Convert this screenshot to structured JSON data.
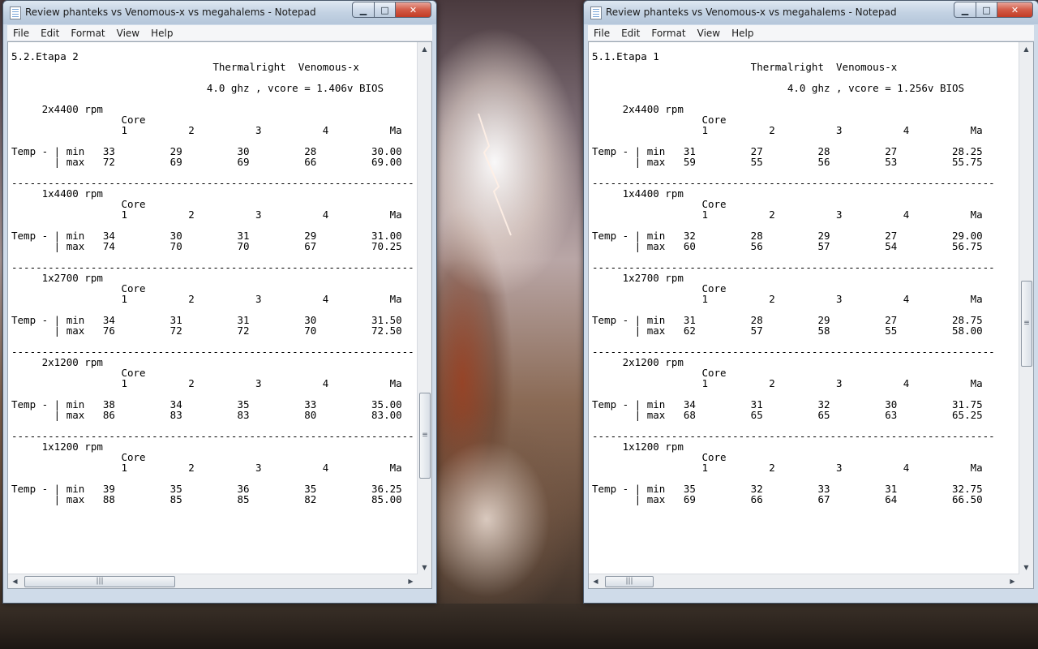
{
  "left_window": {
    "title": "Review phanteks vs Venomous-x vs megahalems - Notepad",
    "menu": [
      "File",
      "Edit",
      "Format",
      "View",
      "Help"
    ],
    "content": "5.2.Etapa 2\n                                 Thermalright  Venomous-x\n\n                                4.0 ghz , vcore = 1.406v BIOS\n\n     2x4400 rpm\n                  Core\n                  1          2          3          4          Ma\n\nTemp - | min   33         29         30         28         30.00\n       | max   72         69         69         66         69.00\n\n------------------------------------------------------------------\n     1x4400 rpm\n                  Core\n                  1          2          3          4          Ma\n\nTemp - | min   34         30         31         29         31.00\n       | max   74         70         70         67         70.25\n\n------------------------------------------------------------------\n     1x2700 rpm\n                  Core\n                  1          2          3          4          Ma\n\nTemp - | min   34         31         31         30         31.50\n       | max   76         72         72         70         72.50\n\n------------------------------------------------------------------\n     2x1200 rpm\n                  Core\n                  1          2          3          4          Ma\n\nTemp - | min   38         34         35         33         35.00\n       | max   86         83         83         80         83.00\n\n------------------------------------------------------------------\n     1x1200 rpm\n                  Core\n                  1          2          3          4          Ma\n\nTemp - | min   39         35         36         35         36.25\n       | max   88         85         85         82         85.00"
  },
  "right_window": {
    "title": "Review phanteks vs Venomous-x vs megahalems - Notepad",
    "menu": [
      "File",
      "Edit",
      "Format",
      "View",
      "Help"
    ],
    "content": "5.1.Etapa 1\n                          Thermalright  Venomous-x\n\n                                4.0 ghz , vcore = 1.256v BIOS\n\n     2x4400 rpm\n                  Core\n                  1          2          3          4          Ma\n\nTemp - | min   31         27         28         27         28.25\n       | max   59         55         56         53         55.75\n\n------------------------------------------------------------------\n     1x4400 rpm\n                  Core\n                  1          2          3          4          Ma\n\nTemp - | min   32         28         29         27         29.00\n       | max   60         56         57         54         56.75\n\n------------------------------------------------------------------\n     1x2700 rpm\n                  Core\n                  1          2          3          4          Ma\n\nTemp - | min   31         28         29         27         28.75\n       | max   62         57         58         55         58.00\n\n------------------------------------------------------------------\n     2x1200 rpm\n                  Core\n                  1          2          3          4          Ma\n\nTemp - | min   34         31         32         30         31.75\n       | max   68         65         65         63         65.25\n\n------------------------------------------------------------------\n     1x1200 rpm\n                  Core\n                  1          2          3          4          Ma\n\nTemp - | min   35         32         33         31         32.75\n       | max   69         66         67         64         66.50"
  },
  "caption_buttons": {
    "minimize": "▁",
    "maximize": "□",
    "close": "✕"
  },
  "icons": [
    "notepad-icon",
    "minimize-icon",
    "maximize-icon",
    "close-icon",
    "scroll-up-icon",
    "scroll-down-icon",
    "scroll-left-icon",
    "scroll-right-icon"
  ],
  "colors": {
    "titlebar": "#c3d2e3",
    "close_button": "#c23b24",
    "editor_bg": "#ffffff"
  }
}
